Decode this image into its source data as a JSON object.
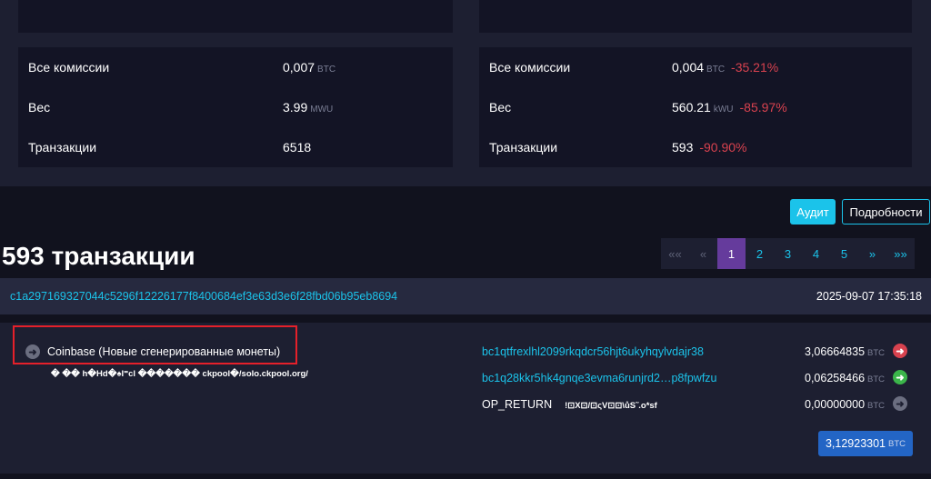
{
  "left_stats": [
    {
      "label": "Все комиссии",
      "value": "0,007",
      "unit": "BTC"
    },
    {
      "label": "Вес",
      "value": "3.99",
      "unit": "MWU"
    },
    {
      "label": "Транзакции",
      "value": "6518",
      "unit": ""
    }
  ],
  "right_stats": [
    {
      "label": "Все комиссии",
      "value": "0,004",
      "unit": "BTC",
      "delta": "-35.21%"
    },
    {
      "label": "Вес",
      "value": "560.21",
      "unit": "kWU",
      "delta": "-85.97%"
    },
    {
      "label": "Транзакции",
      "value": "593",
      "unit": "",
      "delta": "-90.90%"
    }
  ],
  "buttons": {
    "audit": "Аудит",
    "details": "Подробности"
  },
  "transactions_title": "593 транзакции",
  "pagination": [
    "««",
    "«",
    "1",
    "2",
    "3",
    "4",
    "5",
    "»",
    "»»"
  ],
  "pagination_active": "1",
  "transaction": {
    "hash": "c1a297169327044c5296f12226177f8400684ef3e63d3e6f28fbd06b95eb8694",
    "time": "2025-09-07 17:35:18",
    "input_label": "Coinbase (Новые сгенерированные монеты)",
    "coinbase_script": "� �� h�Hd�♠I⁼cl ������� ckpool�/solo.ckpool.org/",
    "outputs": [
      {
        "address": "bc1qtfrexlhl2099rkqdcr56hjt6ukyhqylvdajr38",
        "amount": "3,06664835",
        "unit": "BTC",
        "icon": "arrow-right-red-icon"
      },
      {
        "address": "bc1q28kkr5hk4gnqe3evma6runjrd2…p8fpwfzu",
        "amount": "0,06258466",
        "unit": "BTC",
        "icon": "arrow-right-green-icon"
      },
      {
        "address": "OP_RETURN",
        "op_data": "!⊡X⊡/⊡ςV⊡⊡\\ůS˜.o*sf",
        "amount": "0,00000000",
        "unit": "BTC",
        "icon": "arrow-right-grey-icon"
      }
    ],
    "total": "3,12923301",
    "total_unit": "BTC"
  },
  "colors": {
    "accent": "#1bc3ea",
    "negative": "#d8424f",
    "active_page": "#653b9c",
    "total_badge": "#2365c5",
    "highlight": "#e5202a"
  }
}
